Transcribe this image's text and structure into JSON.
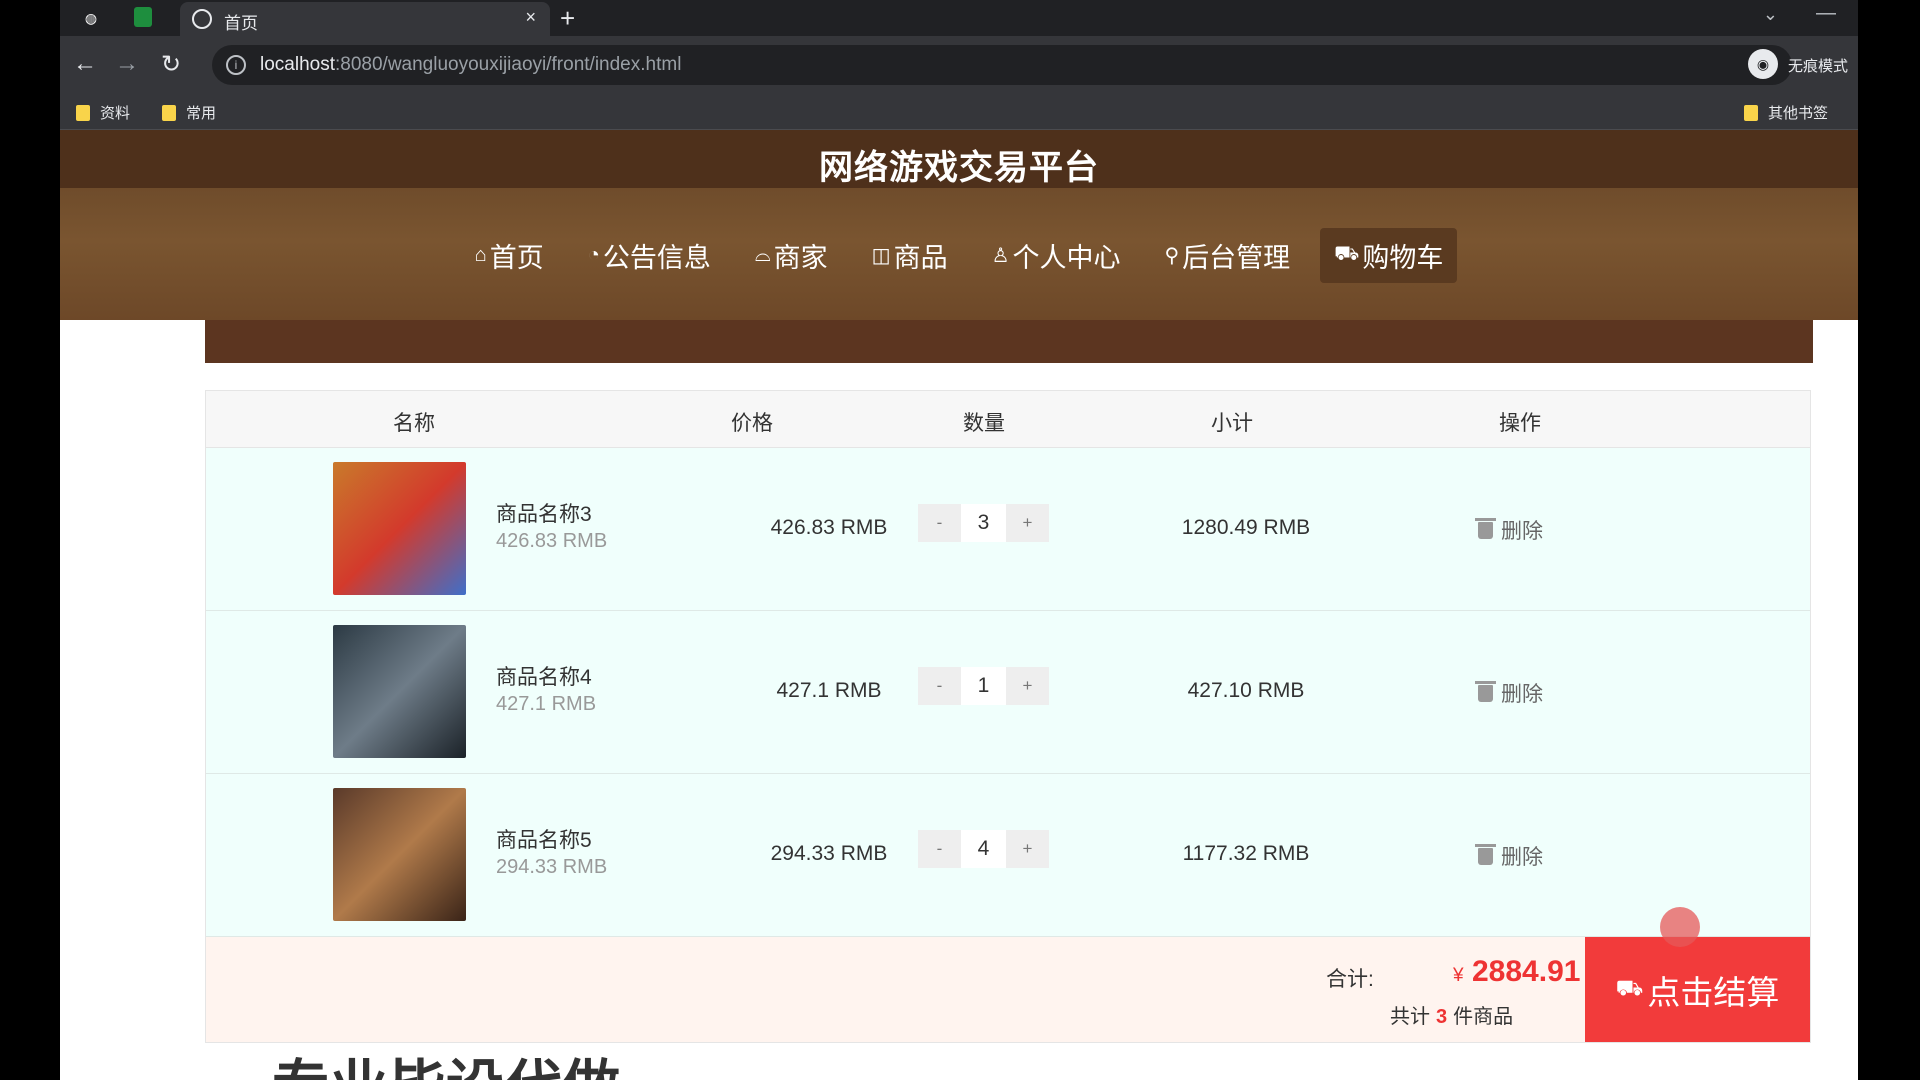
{
  "browser": {
    "tab_title": "首页",
    "new_tab_symbol": "+",
    "close_symbol": "×",
    "url_host": "localhost",
    "url_rest": ":8080/wangluoyouxijiaoyi/front/index.html",
    "profile_label": "无痕模式",
    "bookmarks": [
      {
        "label": "资料"
      },
      {
        "label": "常用"
      },
      {
        "label": "其他书签"
      }
    ]
  },
  "site": {
    "title": "网络游戏交易平台",
    "nav": [
      {
        "icon": "⌂",
        "label": "首页"
      },
      {
        "icon": "◔",
        "label": "公告信息"
      },
      {
        "icon": "⌓",
        "label": "商家"
      },
      {
        "icon": "◫",
        "label": "商品"
      },
      {
        "icon": "♙",
        "label": "个人中心"
      },
      {
        "icon": "⚲",
        "label": "后台管理"
      },
      {
        "icon": "⛟",
        "label": "购物车"
      }
    ]
  },
  "cart": {
    "headers": [
      "名称",
      "价格",
      "数量",
      "小计",
      "操作"
    ],
    "minus": "-",
    "plus": "+",
    "delete_label": "删除",
    "items": [
      {
        "name": "商品名称3",
        "unit_price": "426.83 RMB",
        "price": "426.83 RMB",
        "qty": "3",
        "subtotal": "1280.49 RMB",
        "thumb_colors": [
          "#c97a2b",
          "#d33a2c",
          "#3f6fc9"
        ]
      },
      {
        "name": "商品名称4",
        "unit_price": "427.1 RMB",
        "price": "427.1 RMB",
        "qty": "1",
        "subtotal": "427.10 RMB",
        "thumb_colors": [
          "#2c3a44",
          "#6e7c88",
          "#1b2228"
        ]
      },
      {
        "name": "商品名称5",
        "unit_price": "294.33 RMB",
        "price": "294.33 RMB",
        "qty": "4",
        "subtotal": "1177.32 RMB",
        "thumb_colors": [
          "#5a3a2a",
          "#b07a4a",
          "#3a2418"
        ]
      }
    ],
    "total_label": "合计:",
    "currency": "¥",
    "total": "2884.91",
    "count_prefix": "共计",
    "count": "3",
    "count_suffix": "件商品",
    "checkout_label": "点击结算"
  },
  "bottom_text": "专业毕设代做"
}
